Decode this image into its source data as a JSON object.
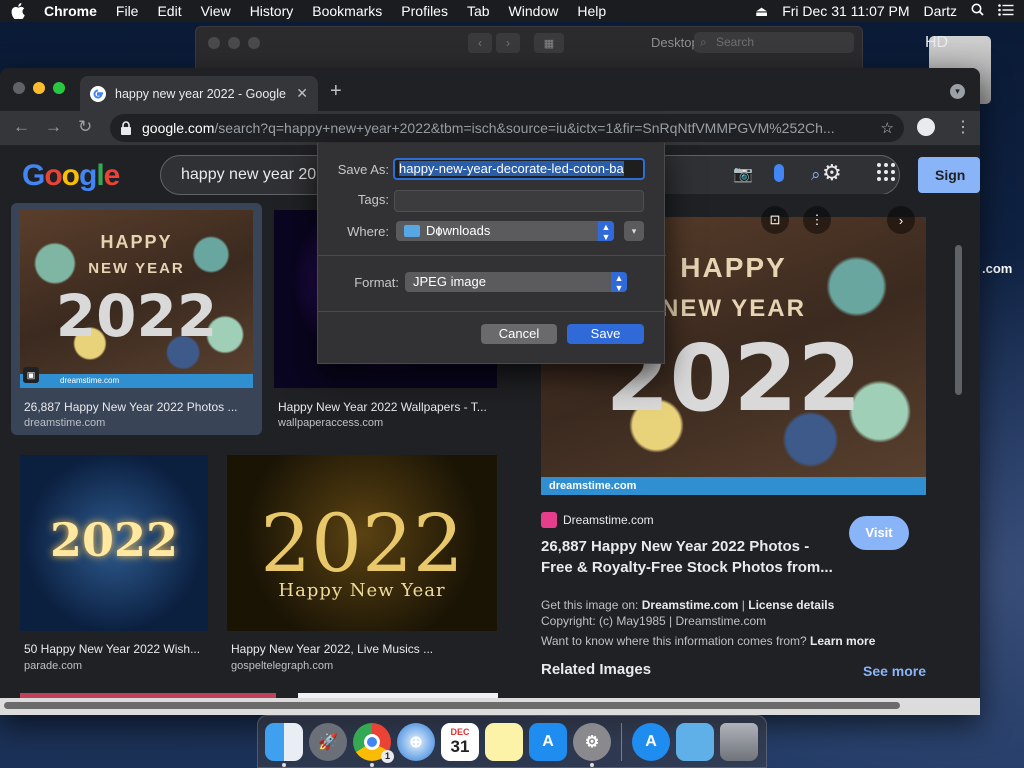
{
  "menubar": {
    "app": "Chrome",
    "items": [
      "File",
      "Edit",
      "View",
      "History",
      "Bookmarks",
      "Profiles",
      "Tab",
      "Window",
      "Help"
    ],
    "datetime": "Fri Dec 31  11:07 PM",
    "user": "Dartz"
  },
  "prefs_window": {
    "title": "Desktop & Screen Saver",
    "search_placeholder": "Search"
  },
  "desktop": {
    "drive_label": "HD",
    "side_text": ".com"
  },
  "chrome": {
    "tab_title": "happy new year 2022 - Google",
    "url_host": "google.com",
    "url_path": "/search?q=happy+new+year+2022&tbm=isch&source=iu&ictx=1&fir=SnRqNtfVMMPGVM%252Ch..."
  },
  "google": {
    "query": "happy new year 20",
    "signin_label": "Sign"
  },
  "results": [
    {
      "caption": "26,887 Happy New Year 2022 Photos ...",
      "source": "dreamstime.com"
    },
    {
      "caption": "Happy New Year 2022 Wallpapers - T...",
      "source": "wallpaperaccess.com"
    },
    {
      "caption": "50 Happy New Year 2022 Wish...",
      "source": "parade.com"
    },
    {
      "caption": "Happy New Year 2022, Live Musics ...",
      "source": "gospeltelegraph.com"
    }
  ],
  "image_text": {
    "happy": "HAPPY",
    "new_year": "NEW YEAR",
    "year": "2022",
    "gold_tagline": "Happy New Year",
    "watermark": "dreamstime.com"
  },
  "preview": {
    "site": "Dreamstime.com",
    "title": "26,887 Happy New Year 2022 Photos - Free & Royalty-Free Stock Photos from...",
    "visit_label": "Visit",
    "license_prefix": "Get this image on:",
    "license_site": "Dreamstime.com",
    "license_sep": "|",
    "license_details": "License details",
    "copyright": "Copyright: (c) May1985 | Dreamstime.com",
    "info_q": "Want to know where this information comes from?",
    "learn_more": "Learn more",
    "related": "Related Images",
    "see_more": "See more"
  },
  "dialog": {
    "save_as_label": "Save As:",
    "save_as_value": "happy-new-year-decorate-led-coton-ba",
    "tags_label": "Tags:",
    "where_label": "Where:",
    "where_value": "Downloads",
    "format_label": "Format:",
    "format_value": "JPEG image",
    "cancel_label": "Cancel",
    "save_label": "Save"
  },
  "dock": {
    "calendar_month": "DEC",
    "calendar_day": "31",
    "chrome_badge": "1"
  }
}
